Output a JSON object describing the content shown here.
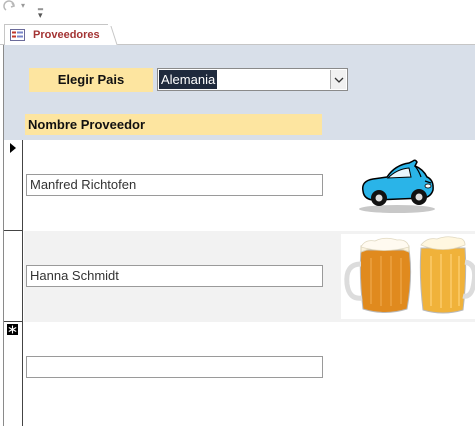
{
  "tab": {
    "label": "Proveedores"
  },
  "header": {
    "country_label": "Elegir Pais",
    "country_value": "Alemania",
    "supplier_column_label": "Nombre Proveedor"
  },
  "records": [
    {
      "name": "Manfred Richtofen",
      "image": "car-cartoon-image",
      "selected": true
    },
    {
      "name": "Hanna Schmidt",
      "image": "beer-mugs-image",
      "selected": false
    },
    {
      "name": "",
      "image": "",
      "new_record": true
    }
  ],
  "colors": {
    "label_bg": "#fde5a0",
    "header_bg": "#d8dfe9",
    "alt_row_bg": "#f2f2f2",
    "tab_text": "#a33333"
  }
}
